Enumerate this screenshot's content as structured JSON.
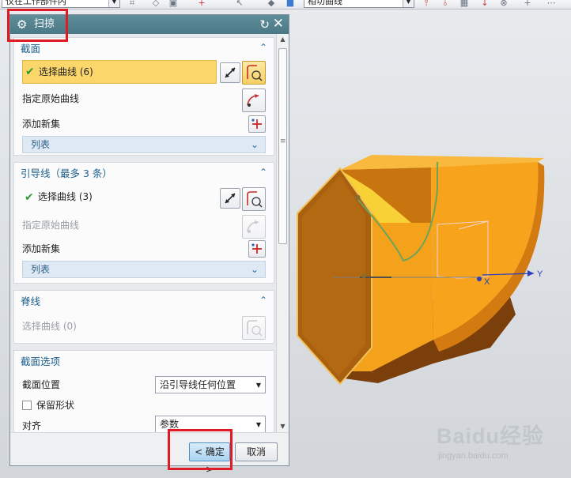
{
  "toolbar": {
    "filter_combo": "仅在工作部件内",
    "curve_rule_combo": "相切曲线"
  },
  "dialog": {
    "title": "扫掠",
    "sections": {
      "section": {
        "title": "截面",
        "select_curve": "选择曲线 (6)",
        "specify_original": "指定原始曲线",
        "add_new_set": "添加新集",
        "list": "列表"
      },
      "guide": {
        "title": "引导线（最多 3 条）",
        "select_curve": "选择曲线 (3)",
        "specify_original": "指定原始曲线",
        "add_new_set": "添加新集",
        "list": "列表"
      },
      "spine": {
        "title": "脊线",
        "select_curve": "选择曲线 (0)"
      },
      "section_options": {
        "title": "截面选项",
        "position_label": "截面位置",
        "position_value": "沿引导线任何位置",
        "preserve_shape": "保留形状",
        "align_label": "对齐",
        "align_value": "参数"
      }
    },
    "ok_button": "< 确定 >",
    "cancel_button": "取消"
  },
  "viewport": {
    "axis_x": "X",
    "axis_y": "Y",
    "model_color": "#F7A31C"
  },
  "watermark": {
    "brand": "Baidu经验",
    "site": "jingyan.baidu.com"
  }
}
